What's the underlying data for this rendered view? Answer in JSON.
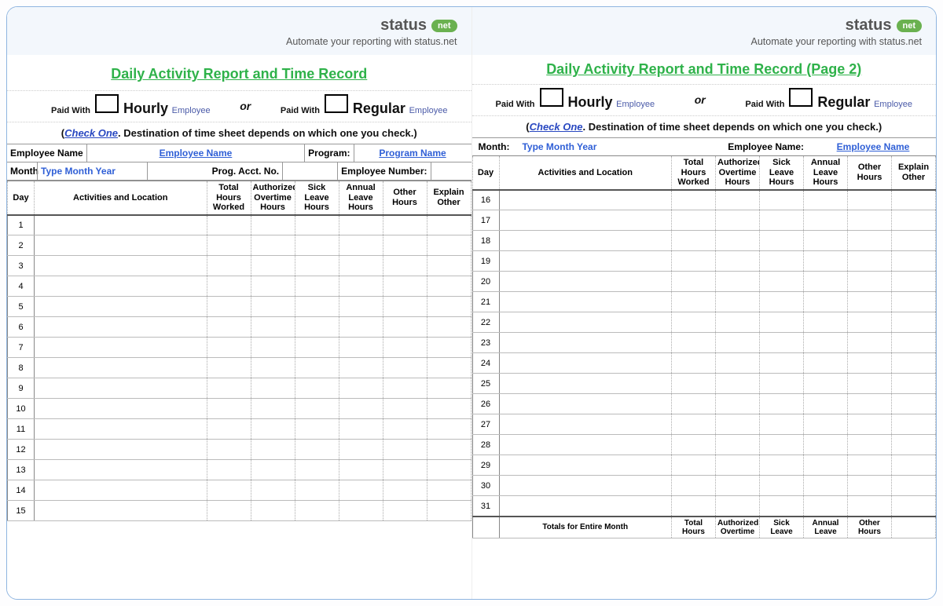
{
  "brand": {
    "name": "status",
    "badge": "net",
    "tagline": "Automate your reporting with status.net"
  },
  "page1": {
    "title": "Daily Activity Report and Time Record",
    "paid_with": "Paid With",
    "hourly": "Hourly",
    "regular": "Regular",
    "employee_suffix": "Employee",
    "or": "or",
    "check_prefix": "(",
    "check_one": "Check One",
    "check_rest": ".  Destination of time sheet depends on which one you check.)",
    "employee_name_label": "Employee Name",
    "employee_name_value": "Employee Name",
    "program_label": "Program:",
    "program_value": "Program Name",
    "month_label": "Month",
    "month_value": "Type Month Year",
    "prog_acct_label": "Prog. Acct. No.",
    "employee_number_label": "Employee Number:",
    "columns": {
      "day": "Day",
      "activities": "Activities and Location",
      "total_hours": "Total Hours Worked",
      "auth_ot": "Authorized Overtime Hours",
      "sick": "Sick Leave Hours",
      "annual": "Annual Leave Hours",
      "other": "Other Hours",
      "explain": "Explain Other"
    },
    "days": [
      "1",
      "2",
      "3",
      "4",
      "5",
      "6",
      "7",
      "8",
      "9",
      "10",
      "11",
      "12",
      "13",
      "14",
      "15"
    ]
  },
  "page2": {
    "title": "Daily Activity Report and Time Record (Page 2)",
    "month_label": "Month:",
    "month_value": "Type Month Year",
    "employee_name_label": "Employee Name:",
    "employee_name_value": "Employee Name",
    "days": [
      "16",
      "17",
      "18",
      "19",
      "20",
      "21",
      "22",
      "23",
      "24",
      "25",
      "26",
      "27",
      "28",
      "29",
      "30",
      "31"
    ],
    "totals_label": "Totals for Entire Month",
    "totals_cols": {
      "total_hours": "Total Hours",
      "auth_ot": "Authorized Overtime",
      "sick": "Sick Leave",
      "annual": "Annual Leave",
      "other": "Other Hours"
    }
  }
}
